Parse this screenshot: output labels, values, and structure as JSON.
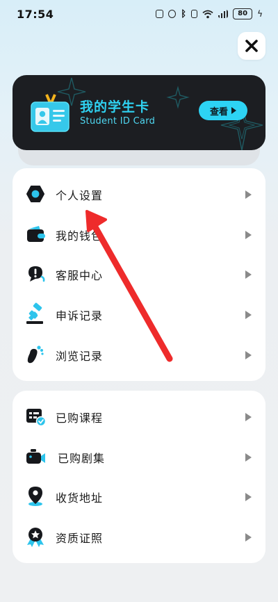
{
  "status_bar": {
    "time": "17:54",
    "battery": "80",
    "icons": [
      "nfc-icon",
      "alarm-icon",
      "bluetooth-icon",
      "vibrate-icon",
      "wifi-icon",
      "signal-icon",
      "battery-icon",
      "charging-icon"
    ]
  },
  "close": {
    "icon": "close-icon"
  },
  "student_card": {
    "title": "我的学生卡",
    "subtitle": "Student ID Card",
    "view_label": "查看",
    "colors": {
      "background": "#1c1e22",
      "accent": "#2dd3f4"
    }
  },
  "menu_group_1": {
    "items": [
      {
        "label": "个人设置",
        "icon": "settings-hex-icon"
      },
      {
        "label": "我的钱包",
        "icon": "wallet-icon"
      },
      {
        "label": "客服中心",
        "icon": "customer-service-icon"
      },
      {
        "label": "申诉记录",
        "icon": "appeal-gavel-icon"
      },
      {
        "label": "浏览记录",
        "icon": "footprint-icon"
      }
    ]
  },
  "menu_group_2": {
    "items": [
      {
        "label": "已购课程",
        "icon": "purchased-course-icon"
      },
      {
        "label": "已购剧集",
        "icon": "purchased-series-camera-icon"
      },
      {
        "label": "收货地址",
        "icon": "location-pin-icon"
      },
      {
        "label": "资质证照",
        "icon": "certificate-badge-icon"
      }
    ]
  },
  "annotation": {
    "color": "#ee2b2b"
  }
}
